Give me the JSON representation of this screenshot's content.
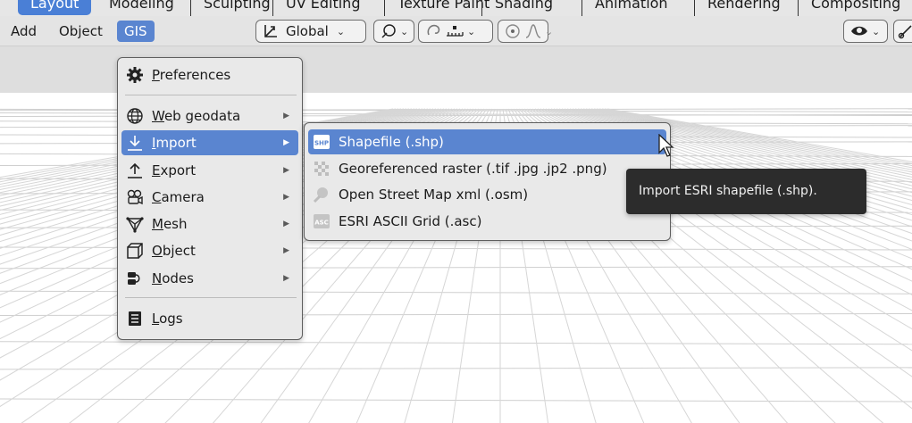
{
  "workspace_tabs": [
    "Layout",
    "Modeling",
    "Sculpting",
    "UV Editing",
    "Texture Paint",
    "Shading",
    "Animation",
    "Rendering",
    "Compositing"
  ],
  "header": {
    "menus": [
      "Add",
      "Object",
      "GIS"
    ],
    "transform_orientation": "Global"
  },
  "gis_menu": {
    "items": [
      {
        "label": "Preferences",
        "icon": "gear-icon",
        "submenu": false
      },
      {
        "label": "Web geodata",
        "icon": "globe-icon",
        "submenu": true
      },
      {
        "label": "Import",
        "icon": "import-icon",
        "submenu": true
      },
      {
        "label": "Export",
        "icon": "export-icon",
        "submenu": true
      },
      {
        "label": "Camera",
        "icon": "camera-icon",
        "submenu": true
      },
      {
        "label": "Mesh",
        "icon": "mesh-icon",
        "submenu": true
      },
      {
        "label": "Object",
        "icon": "cube-icon",
        "submenu": true
      },
      {
        "label": "Nodes",
        "icon": "nodes-icon",
        "submenu": true
      },
      {
        "label": "Logs",
        "icon": "log-icon",
        "submenu": false
      }
    ]
  },
  "import_menu": {
    "items": [
      {
        "label": "Shapefile (.shp)",
        "icon": "shp-icon",
        "icon_text": "SHP"
      },
      {
        "label": "Georeferenced raster (.tif .jpg .jp2 .png)",
        "icon": "raster-icon",
        "icon_text": ""
      },
      {
        "label": "Open Street Map xml (.osm)",
        "icon": "osm-icon",
        "icon_text": ""
      },
      {
        "label": "ESRI ASCII Grid (.asc)",
        "icon": "asc-icon",
        "icon_text": "ASC"
      }
    ]
  },
  "tooltip": {
    "text": "Import ESRI shapefile (.shp)."
  },
  "colors": {
    "highlight": "#5a85d0",
    "active_tab": "#4a7fd6",
    "menu_bg": "#e9e9e9",
    "tooltip_bg": "#2c2c2c"
  }
}
